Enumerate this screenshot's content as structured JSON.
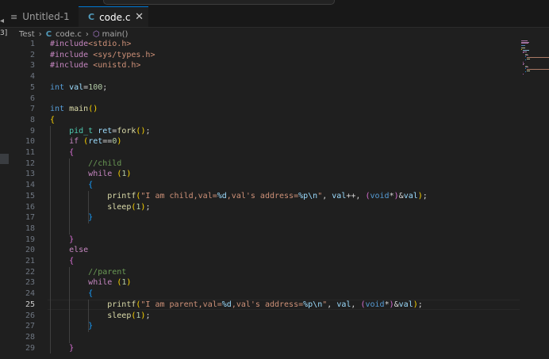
{
  "tabs": [
    {
      "label": "Untitled-1",
      "icon": "lines-icon",
      "active": false
    },
    {
      "label": "code.c",
      "icon": "c-file-icon",
      "active": true
    }
  ],
  "tab_close_glyph": "✕",
  "left_panel_label": "3]",
  "breadcrumb": {
    "folder": "Test",
    "file": "code.c",
    "symbol": "main()"
  },
  "editor": {
    "current_line": 25,
    "lines": [
      {
        "n": "1",
        "code": "#include<stdio.h>"
      },
      {
        "n": "2",
        "code": "#include <sys/types.h>"
      },
      {
        "n": "3",
        "code": "#include <unistd.h>"
      },
      {
        "n": "4",
        "code": ""
      },
      {
        "n": "5",
        "code": "int val=100;"
      },
      {
        "n": "6",
        "code": ""
      },
      {
        "n": "7",
        "code": "int main()"
      },
      {
        "n": "8",
        "code": "{"
      },
      {
        "n": "9",
        "code": "    pid_t ret=fork();"
      },
      {
        "n": "10",
        "code": "    if (ret==0)"
      },
      {
        "n": "11",
        "code": "    {"
      },
      {
        "n": "12",
        "code": "        //child"
      },
      {
        "n": "13",
        "code": "        while (1)"
      },
      {
        "n": "14",
        "code": "        {"
      },
      {
        "n": "15",
        "code": "            printf(\"I am child,val=%d,val's address=%p\\n\", val++, (void*)&val);"
      },
      {
        "n": "16",
        "code": "            sleep(1);"
      },
      {
        "n": "17",
        "code": "        }"
      },
      {
        "n": "18",
        "code": ""
      },
      {
        "n": "19",
        "code": "    }"
      },
      {
        "n": "20",
        "code": "    else"
      },
      {
        "n": "21",
        "code": "    {"
      },
      {
        "n": "22",
        "code": "        //parent"
      },
      {
        "n": "23",
        "code": "        while (1)"
      },
      {
        "n": "24",
        "code": "        {"
      },
      {
        "n": "25",
        "code": "            printf(\"I am parent,val=%d,val's address=%p\\n\", val, (void*)&val);"
      },
      {
        "n": "26",
        "code": "            sleep(1);"
      },
      {
        "n": "27",
        "code": "        }"
      },
      {
        "n": "28",
        "code": ""
      },
      {
        "n": "29",
        "code": "    }"
      }
    ]
  },
  "colors": {
    "editor_bg": "#1f1f1f",
    "tab_active_border": "#0078d4",
    "c_icon": "#519aba"
  }
}
